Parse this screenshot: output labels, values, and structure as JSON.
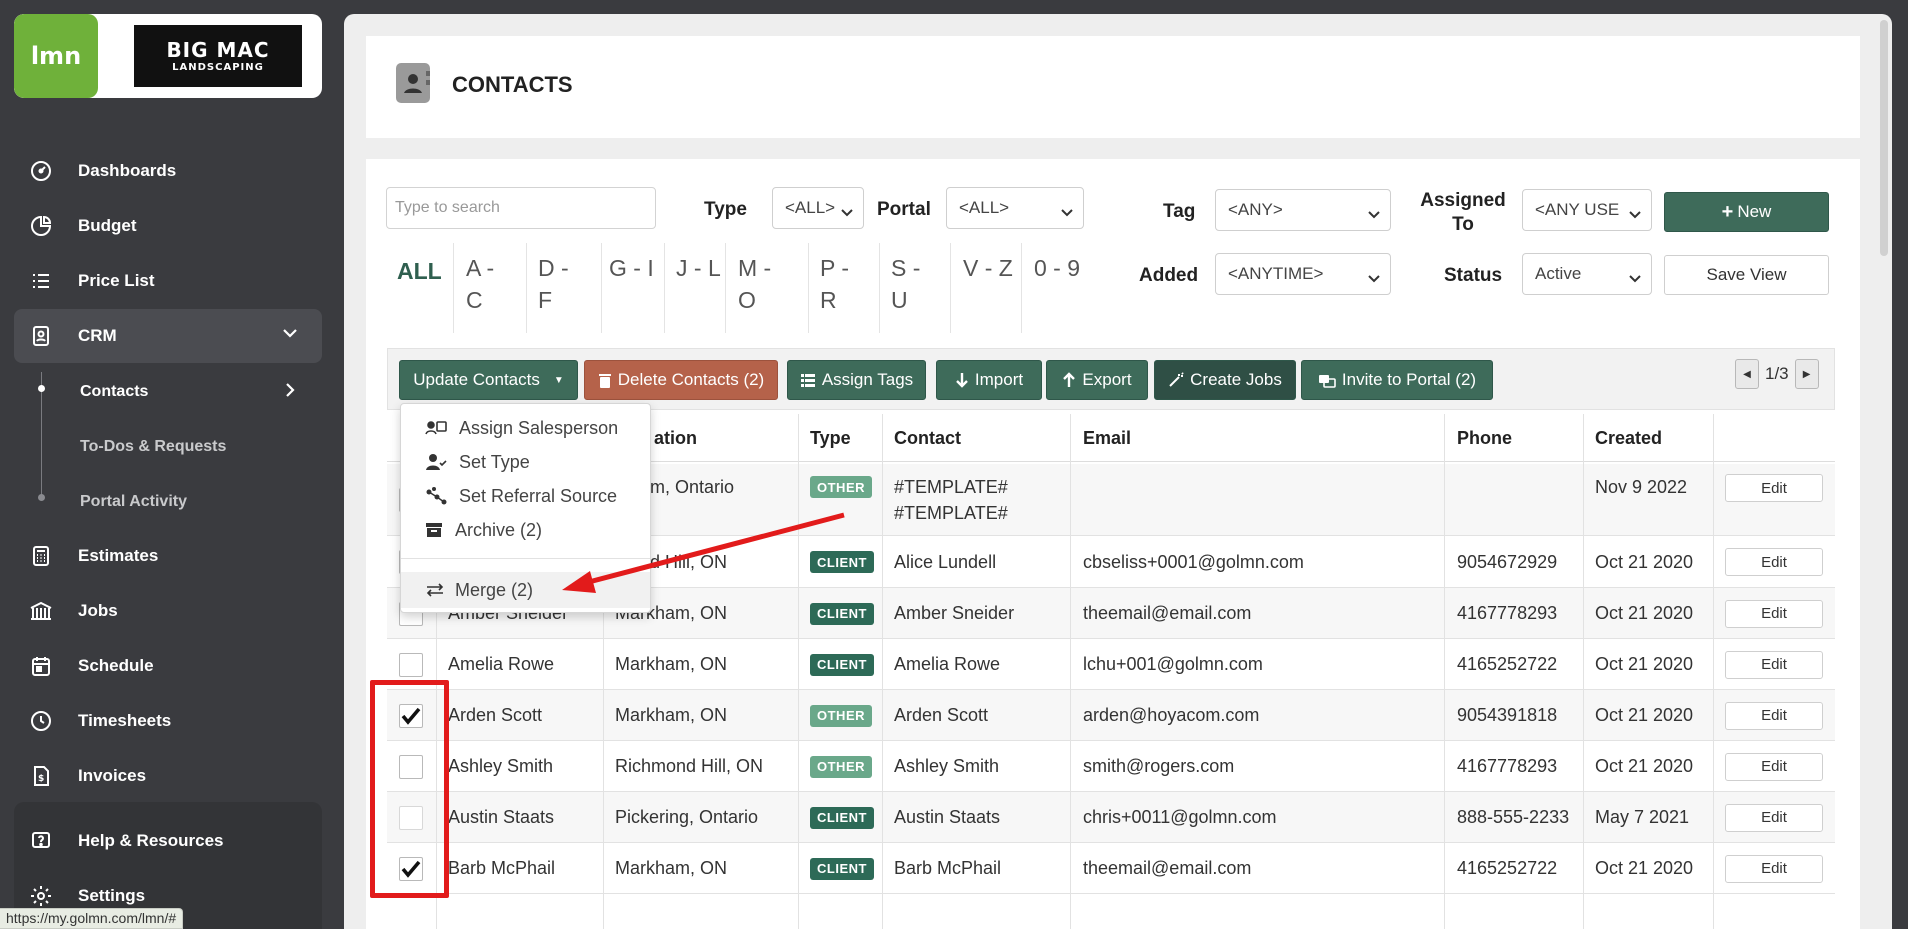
{
  "sidebar": {
    "logo_lmn": "lmn",
    "logo_big_l1": "BIG MAC",
    "logo_big_l2": "LANDSCAPING",
    "items": [
      {
        "label": "Dashboards"
      },
      {
        "label": "Budget"
      },
      {
        "label": "Price List"
      },
      {
        "label": "CRM"
      },
      {
        "label": "Estimates"
      },
      {
        "label": "Jobs"
      },
      {
        "label": "Schedule"
      },
      {
        "label": "Timesheets"
      },
      {
        "label": "Invoices"
      },
      {
        "label": "Help & Resources"
      },
      {
        "label": "Settings"
      }
    ],
    "sub_items": [
      {
        "label": "Contacts"
      },
      {
        "label": "To-Dos & Requests"
      },
      {
        "label": "Portal Activity"
      }
    ]
  },
  "status_url": "https://my.golmn.com/lmn/#",
  "page": {
    "title": "CONTACTS"
  },
  "filters": {
    "search_placeholder": "Type to search",
    "type_label": "Type",
    "type_value": "<ALL>",
    "portal_label": "Portal",
    "portal_value": "<ALL>",
    "tag_label": "Tag",
    "tag_value": "<ANY>",
    "assigned_label": "Assigned To",
    "assigned_value": "<ANY USE",
    "added_label": "Added",
    "added_value": "<ANYTIME>",
    "status_label": "Status",
    "status_value": "Active",
    "new_label": "New",
    "save_view_label": "Save View"
  },
  "alpha": [
    "ALL",
    "A - C",
    "D - F",
    "G - I",
    "J - L",
    "M - O",
    "P - R",
    "S - U",
    "V - Z",
    "0 - 9"
  ],
  "toolbar": {
    "update": "Update Contacts",
    "delete": "Delete Contacts (2)",
    "assign_tags": "Assign Tags",
    "import": "Import",
    "export": "Export",
    "create_jobs": "Create Jobs",
    "invite": "Invite to Portal (2)",
    "pager": "1/3"
  },
  "dropdown": {
    "assign_salesperson": "Assign Salesperson",
    "set_type": "Set Type",
    "set_referral": "Set Referral Source",
    "archive": "Archive (2)",
    "merge": "Merge (2)"
  },
  "table": {
    "headers": [
      "ation",
      "Type",
      "Contact",
      "Email",
      "Phone",
      "Created"
    ],
    "edit_label": "Edit",
    "rows": [
      {
        "name": "",
        "location": "rkham, Ontario",
        "type": "OTHER",
        "contact": "#TEMPLATE#",
        "contact2": "#TEMPLATE#",
        "email": "",
        "phone": "",
        "created": "Nov 9 2022",
        "checked": false
      },
      {
        "name": "",
        "location": "mond Hill, ON",
        "type": "CLIENT",
        "contact": "Alice Lundell",
        "email": "cbseliss+0001@golmn.com",
        "phone": "9054672929",
        "created": "Oct 21 2020",
        "checked": false
      },
      {
        "name": "Amber Sneider",
        "location": "Markham, ON",
        "type": "CLIENT",
        "contact": "Amber Sneider",
        "email": "theemail@email.com",
        "phone": "4167778293",
        "created": "Oct 21 2020",
        "checked": false
      },
      {
        "name": "Amelia Rowe",
        "location": "Markham, ON",
        "type": "CLIENT",
        "contact": "Amelia Rowe",
        "email": "lchu+001@golmn.com",
        "phone": "4165252722",
        "created": "Oct 21 2020",
        "checked": false
      },
      {
        "name": "Arden Scott",
        "location": "Markham, ON",
        "type": "OTHER",
        "contact": "Arden Scott",
        "email": "arden@hoyacom.com",
        "phone": "9054391818",
        "created": "Oct 21 2020",
        "checked": true
      },
      {
        "name": "Ashley Smith",
        "location": "Richmond Hill, ON",
        "type": "OTHER",
        "contact": "Ashley Smith",
        "email": "smith@rogers.com",
        "phone": "4167778293",
        "created": "Oct 21 2020",
        "checked": false
      },
      {
        "name": "Austin Staats",
        "location": "Pickering, Ontario",
        "type": "CLIENT",
        "contact": "Austin Staats",
        "email": "chris+0011@golmn.com",
        "phone": "888-555-2233",
        "created": "May 7 2021",
        "checked": false
      },
      {
        "name": "Barb McPhail",
        "location": "Markham, ON",
        "type": "CLIENT",
        "contact": "Barb McPhail",
        "email": "theemail@email.com",
        "phone": "4165252722",
        "created": "Oct 21 2020",
        "checked": true
      }
    ]
  },
  "colors": {
    "brand_green": "#3e6b5a",
    "delete_red": "#b5624a",
    "annotation_red": "#e21b1b",
    "lmn_green": "#6fb13a"
  }
}
